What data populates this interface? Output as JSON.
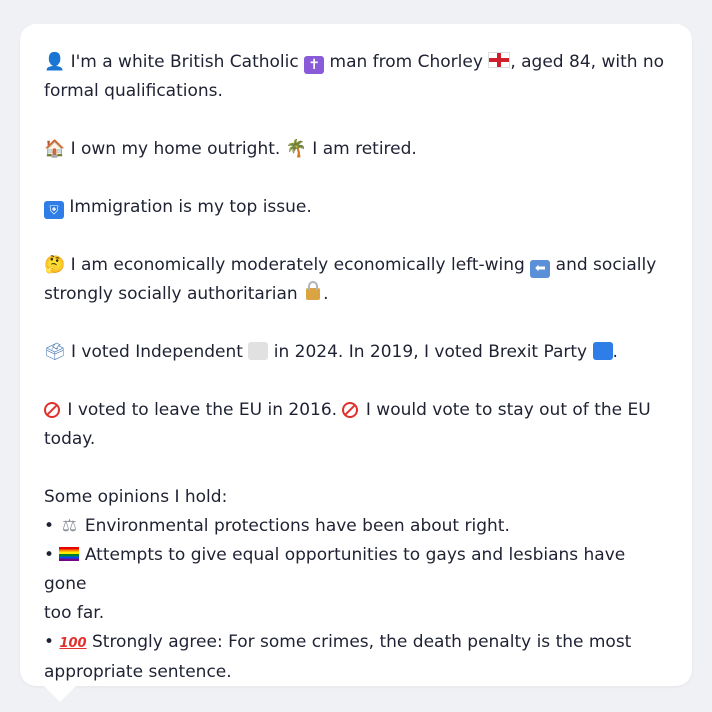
{
  "profile": {
    "identity": {
      "icon": "person-silhouette-icon",
      "text_1": "I'm a white British Catholic",
      "religion_icon": "latin-cross-icon",
      "text_2": "man from Chorley",
      "region_icon": "england-flag-icon",
      "text_3": ", aged 84, with no",
      "text_4": "formal qualifications."
    },
    "home": {
      "house_icon": "house-icon",
      "text_1": "I own my home outright.",
      "retired_icon": "palm-tree-icon",
      "text_2": "I am retired."
    },
    "issue": {
      "icon": "passport-control-icon",
      "text": "Immigration is my top issue."
    },
    "ideology": {
      "icon": "thinking-face-icon",
      "text_1": "I am economically moderately economically left-wing",
      "left_icon": "left-arrow-icon",
      "text_2": "and socially",
      "text_3": "strongly socially authoritarian",
      "lock_icon": "lock-icon",
      "text_4": "."
    },
    "vote": {
      "icon": "ballot-box-icon",
      "text_1": "I voted Independent",
      "party_2024_color": "#e1e1e1",
      "text_2": "in 2024. In 2019, I voted Brexit Party",
      "party_2019_color": "#2f7de6",
      "text_3": "."
    },
    "eu": {
      "icon": "no-entry-icon",
      "text_1": "I voted to leave the EU in 2016.",
      "icon_2": "no-entry-icon",
      "text_2": "I would vote to stay out of the EU",
      "text_3": "today."
    },
    "opinions": {
      "heading": "Some opinions I hold:",
      "bullet": "•",
      "items": [
        {
          "icon": "balance-scale-icon",
          "line_1": "Environmental protections have been about right.",
          "line_2": ""
        },
        {
          "icon": "rainbow-flag-icon",
          "line_1": "Attempts to give equal opportunities to gays and lesbians have gone",
          "line_2": "too far."
        },
        {
          "icon": "hundred-points-icon",
          "line_1": "Strongly agree: For some crimes, the death penalty is the most",
          "line_2": "appropriate sentence."
        }
      ]
    }
  },
  "colors": {
    "background": "#f0f1f4",
    "bubble": "#ffffff",
    "text": "#1f2233"
  }
}
